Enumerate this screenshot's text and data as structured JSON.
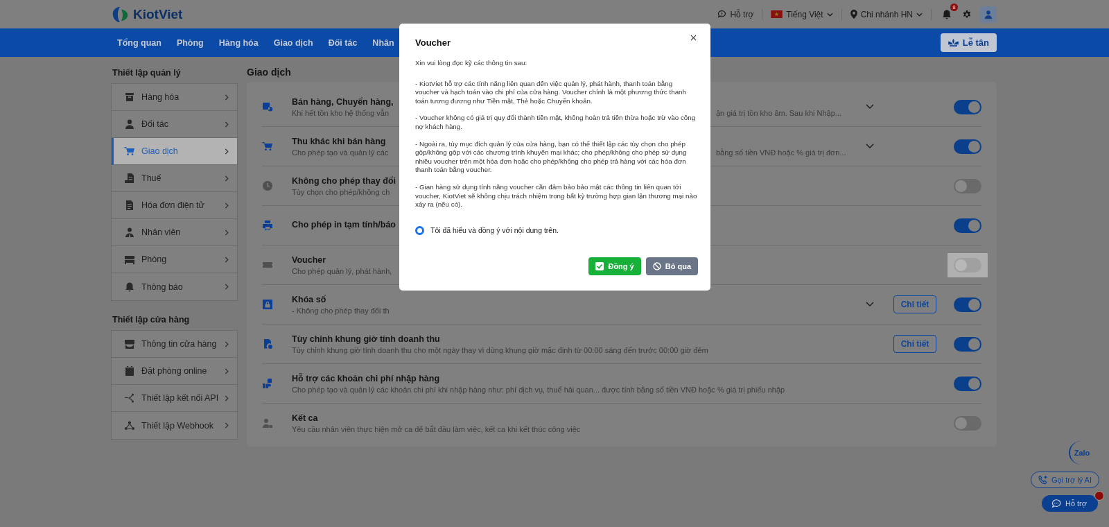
{
  "header": {
    "logo": "KiotViet",
    "support": "Hỗ trợ",
    "language": "Tiếng Việt",
    "branch": "Chi nhánh HN",
    "notification_count": "8"
  },
  "nav": {
    "items": [
      {
        "label": "Tổng quan"
      },
      {
        "label": "Phòng"
      },
      {
        "label": "Hàng hóa"
      },
      {
        "label": "Giao dịch"
      },
      {
        "label": "Đối tác"
      },
      {
        "label": "Nhân"
      }
    ],
    "reception_button": "Lễ tân"
  },
  "sidebar": {
    "sections": [
      {
        "title": "Thiết lập quản lý",
        "items": [
          {
            "label": "Hàng hóa",
            "selected": false
          },
          {
            "label": "Đối tác",
            "selected": false
          },
          {
            "label": "Giao dịch",
            "selected": true
          },
          {
            "label": "Thuế",
            "selected": false
          },
          {
            "label": "Hóa đơn điện tử",
            "selected": false
          },
          {
            "label": "Nhân viên",
            "selected": false
          },
          {
            "label": "Phòng",
            "selected": false
          },
          {
            "label": "Thông báo",
            "selected": false
          }
        ]
      },
      {
        "title": "Thiết lập cửa hàng",
        "items": [
          {
            "label": "Thông tin cửa hàng",
            "selected": false
          },
          {
            "label": "Đặt phòng online",
            "selected": false
          },
          {
            "label": "Thiết lập kết nối API",
            "selected": false
          },
          {
            "label": "Thiết lập Webhook",
            "selected": false
          }
        ]
      }
    ]
  },
  "content": {
    "title": "Giao dịch",
    "settings": [
      {
        "title": "Bán hàng, Chuyển hàng,",
        "description": "Khi hết tồn kho hệ thống vẫn",
        "description_right": "ận giá trị tồn kho âm. Sau khi Nhập...",
        "expandable": true,
        "on": true,
        "focused": false
      },
      {
        "title": "Thu khác khi bán hàng",
        "description": "Cho phép tạo và quản lý các",
        "description_right": "bằng số tiền VNĐ hoặc % giá trị đơn...",
        "expandable": true,
        "on": true,
        "focused": false
      },
      {
        "title": "Không cho phép thay đổi",
        "description": "Tùy chọn cho phép/không ch",
        "expandable": false,
        "on": false,
        "focused": false
      },
      {
        "title": "Cho phép in tạm tính/báo",
        "expandable": false,
        "on": true,
        "focused": false
      },
      {
        "title": "Voucher",
        "description": "Cho phép quản lý, phát hành,",
        "expandable": false,
        "on": false,
        "focused": true
      },
      {
        "title": "Khóa sổ",
        "description": "- Không cho phép thay đổi th",
        "expandable": true,
        "detail_button": "Chi tiết",
        "on": true,
        "focused": false
      },
      {
        "title": "Tùy chỉnh khung giờ tính doanh thu",
        "description": "Tùy chỉnh khung giờ tính doanh thu cho một ngày thay vì dùng khung giờ mặc định từ 00:00 sáng đến trước 00:00 giờ đêm",
        "expandable": false,
        "detail_button": "Chi tiết",
        "on": true,
        "focused": false
      },
      {
        "title": "Hỗ trợ các khoản chi phí nhập hàng",
        "description": "Cho phép tạo và quản lý các khoản chi phí khi nhập hàng như: phí dịch vụ, thuế hải quan... được tính bằng số tiền VNĐ hoặc % giá trị phiếu nhập",
        "expandable": false,
        "on": true,
        "focused": false
      },
      {
        "title": "Kết ca",
        "description": "Yêu cầu nhân viên thực hiện mở ca để bắt đầu làm việc, kết ca khi kết thúc công việc",
        "expandable": false,
        "on": false,
        "focused": false
      }
    ]
  },
  "modal": {
    "title": "Voucher",
    "intro": "Xin vui lòng đọc kỹ các thông tin sau:",
    "paragraphs": [
      "- KiotViet hỗ trợ các tính năng liên quan đến việc quản lý, phát hành, thanh toán bằng voucher và hạch toán vào chi phí của cửa hàng. Voucher chính là một phương thức thanh toán tương đương như Tiền mặt, Thẻ hoặc Chuyển khoản.",
      "- Voucher không có giá trị quy đổi thành tiền mặt, không hoàn trả tiền thừa hoặc trừ vào công nợ khách hàng.",
      "- Ngoài ra, tùy mục đích quản lý của cửa hàng, bạn có thể thiết lập các tùy chọn cho phép gộp/không gộp với các chương trình khuyến mại khác; cho phép/không cho phép sử dụng nhiều voucher trên một hóa đơn hoặc cho phép/không cho phép trả hàng với các hóa đơn thanh toán bằng voucher.",
      "- Gian hàng sử dụng tính năng voucher cần đảm bảo bảo mật các thông tin liên quan tới voucher, KiotViet sẽ không chịu trách nhiệm trong bất kỳ trường hợp gian lận thương mại nào xảy ra (nếu có)."
    ],
    "agreement": {
      "label": "Tôi đã hiểu và đồng ý với nội dung trên.",
      "selected": true
    },
    "buttons": [
      {
        "kind": "confirm",
        "label": "Đồng ý"
      },
      {
        "kind": "cancel",
        "label": "Bỏ qua"
      }
    ]
  },
  "floating": {
    "zalo": "Zalo",
    "ai_button": "Gọi trợ lý AI",
    "support_button": "Hỗ trợ",
    "support_badge": true
  }
}
